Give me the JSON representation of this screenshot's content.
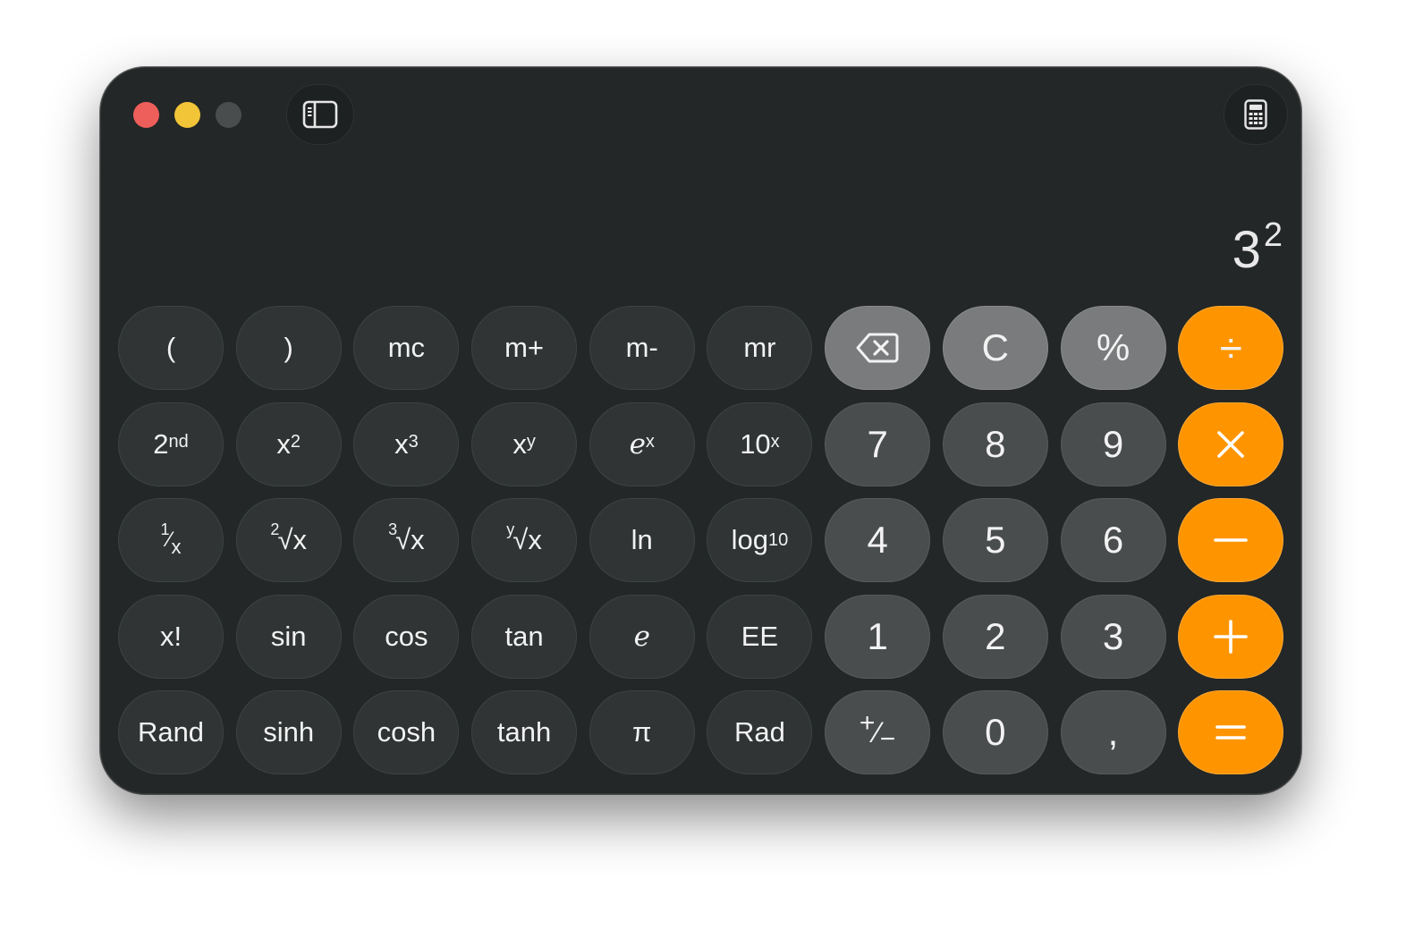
{
  "display": {
    "base": "3",
    "exponent": "2"
  },
  "icons": {
    "sidebar": "sidebar-toggle-icon",
    "mode": "calculator-icon",
    "backspace": "backspace-icon"
  },
  "colors": {
    "window": "#232727",
    "function_key": "#303434",
    "number_key": "#4a4d4e",
    "light_key": "#7a7b7c",
    "operator_key": "#fe9500",
    "close": "#ee5e5a",
    "minimize": "#f2c437",
    "zoom": "#4a4d4e"
  },
  "keys": {
    "open_paren": "(",
    "close_paren": ")",
    "mc": "mc",
    "m_plus": "m+",
    "m_minus": "m-",
    "mr": "mr",
    "clear": "C",
    "percent": "%",
    "divide": "÷",
    "second": "2",
    "second_sup": "nd",
    "x_sq": "x",
    "x_sq_sup": "2",
    "x_cube": "x",
    "x_cube_sup": "3",
    "x_pow_y": "x",
    "x_pow_y_sup": "y",
    "e_pow_x": "e",
    "e_pow_x_sup": "x",
    "ten_pow_x": "10",
    "ten_pow_x_sup": "x",
    "seven": "7",
    "eight": "8",
    "nine": "9",
    "multiply": "×",
    "reciprocal_num": "1",
    "reciprocal_den": "x",
    "sqrt_idx": "2",
    "sqrt_arg": "x",
    "cbrt_idx": "3",
    "cbrt_arg": "x",
    "yroot_idx": "y",
    "yroot_arg": "x",
    "ln": "ln",
    "log10": "log",
    "log10_sub": "10",
    "four": "4",
    "five": "5",
    "six": "6",
    "minus": "−",
    "factorial": "x!",
    "sin": "sin",
    "cos": "cos",
    "tan": "tan",
    "e": "e",
    "ee": "EE",
    "one": "1",
    "two": "2",
    "three": "3",
    "plus": "+",
    "rand": "Rand",
    "sinh": "sinh",
    "cosh": "cosh",
    "tanh": "tanh",
    "pi": "π",
    "rad": "Rad",
    "sign_plus": "+",
    "sign_minus": "−",
    "zero": "0",
    "decimal": ",",
    "equals": "="
  }
}
